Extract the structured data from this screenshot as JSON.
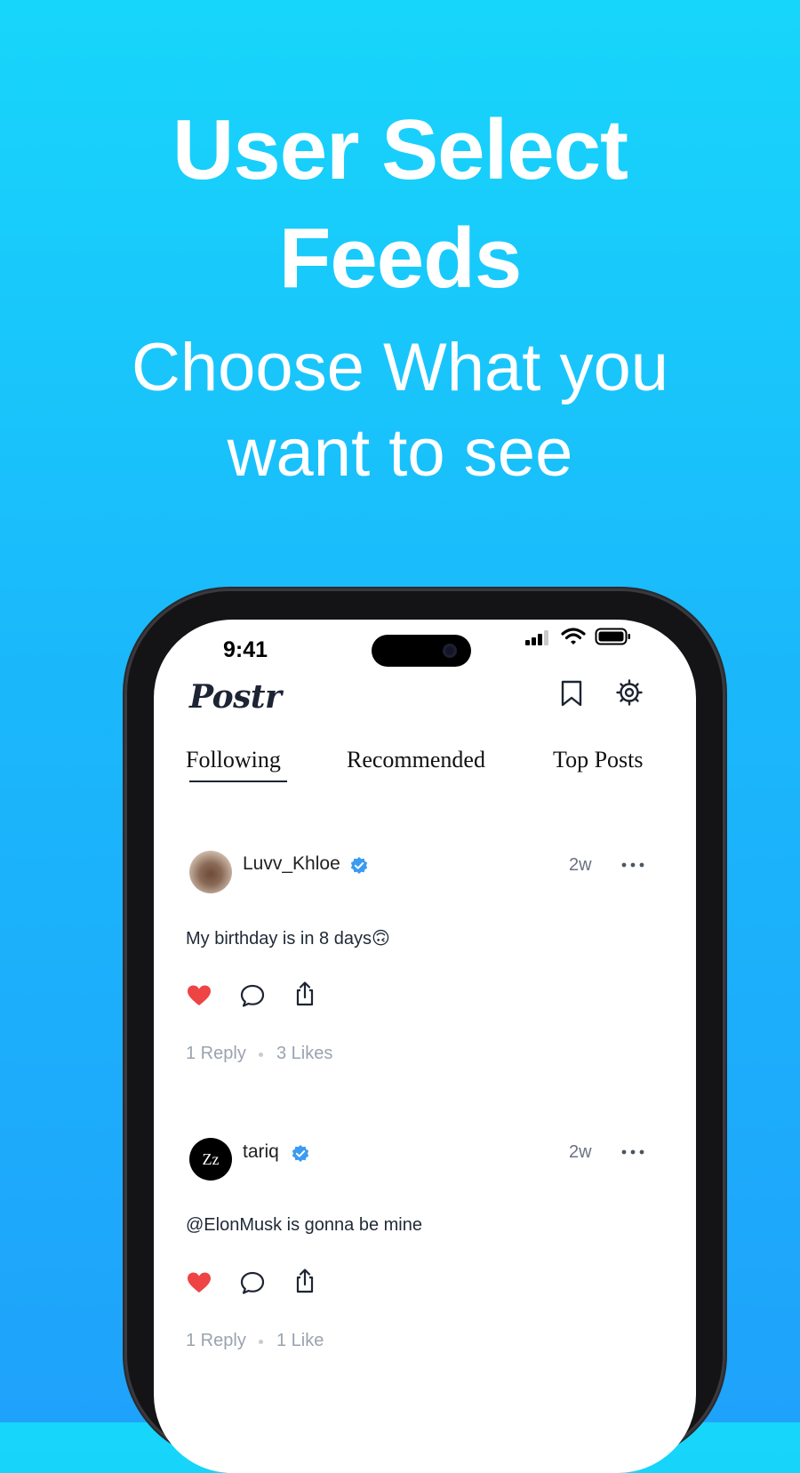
{
  "promo": {
    "title_line1": "User Select",
    "title_line2": "Feeds",
    "subtitle_line1": "Choose What you",
    "subtitle_line2": "want to see"
  },
  "status_bar": {
    "time": "9:41"
  },
  "app": {
    "logo": "Postr",
    "header_icons": [
      "bookmark-icon",
      "settings-icon"
    ],
    "tabs": [
      {
        "label": "Following",
        "selected": true
      },
      {
        "label": "Recommended",
        "selected": false
      },
      {
        "label": "Top Posts",
        "selected": false
      }
    ]
  },
  "posts": [
    {
      "username": "Luvv_Khloe",
      "verified": true,
      "age": "2w",
      "text": "My birthday is in 8 days",
      "emoji": "🙃",
      "liked": true,
      "replies": "1 Reply",
      "likes": "3 Likes"
    },
    {
      "username": "tariq",
      "avatar_text": "Zz",
      "verified": true,
      "age": "2w",
      "text": "@ElonMusk is gonna be mine",
      "liked": true,
      "replies": "1 Reply",
      "likes": "1 Like"
    }
  ],
  "colors": {
    "background_top": "#17d6fb",
    "background_bottom": "#1fa2fb",
    "heart": "#ef4444",
    "verified_badge": "#3b9bf0",
    "text_dark": "#1d2433",
    "muted": "#9aa3af"
  }
}
